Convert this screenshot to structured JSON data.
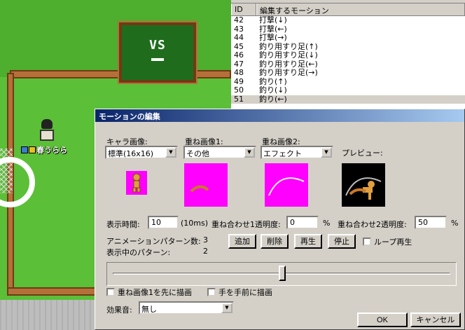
{
  "game": {
    "scoreboard_text": "VS",
    "player_name": "春うらら"
  },
  "motion_list": {
    "header_id": "ID",
    "header_name": "編集するモーション",
    "rows": [
      {
        "id": "42",
        "name": "打撃(↓)"
      },
      {
        "id": "43",
        "name": "打撃(←)"
      },
      {
        "id": "44",
        "name": "打撃(→)"
      },
      {
        "id": "45",
        "name": "釣り用すり足(↑)"
      },
      {
        "id": "46",
        "name": "釣り用すり足(↓)"
      },
      {
        "id": "47",
        "name": "釣り用すり足(←)"
      },
      {
        "id": "48",
        "name": "釣り用すり足(→)"
      },
      {
        "id": "49",
        "name": "釣り(↑)"
      },
      {
        "id": "50",
        "name": "釣り(↓)"
      },
      {
        "id": "51",
        "name": "釣り(←)"
      }
    ]
  },
  "dialog": {
    "title": "モーションの編集",
    "chara_label": "キャラ画像:",
    "chara_value": "標準(16x16)",
    "overlay1_label": "重ね画像1:",
    "overlay1_value": "その他",
    "overlay2_label": "重ね画像2:",
    "overlay2_value": "エフェクト",
    "preview_label": "プレビュー:",
    "display_time_label": "表示時間:",
    "display_time_value": "10",
    "display_time_unit": "(10ms)",
    "overlay1_alpha_label": "重ね合わせ1透明度:",
    "overlay1_alpha_value": "0",
    "overlay2_alpha_label": "重ね合わせ2透明度:",
    "overlay2_alpha_value": "50",
    "percent": "%",
    "pattern_count_label": "アニメーションパターン数:",
    "pattern_count_value": "3",
    "current_pattern_label": "表示中のパターン:",
    "current_pattern_value": "2",
    "add_button": "追加",
    "delete_button": "削除",
    "play_button": "再生",
    "stop_button": "停止",
    "loop_label": "ループ再生",
    "slider_fraction": 0.5,
    "draw_overlay1_first_label": "重ね画像1を先に描画",
    "hand_front_label": "手を手前に描画",
    "sound_label": "効果音:",
    "sound_value": "無し",
    "ok_button": "OK",
    "cancel_button": "キャンセル"
  },
  "colors": {
    "preview_bg": "#ff00ff",
    "titlebar": "#0a246a"
  }
}
